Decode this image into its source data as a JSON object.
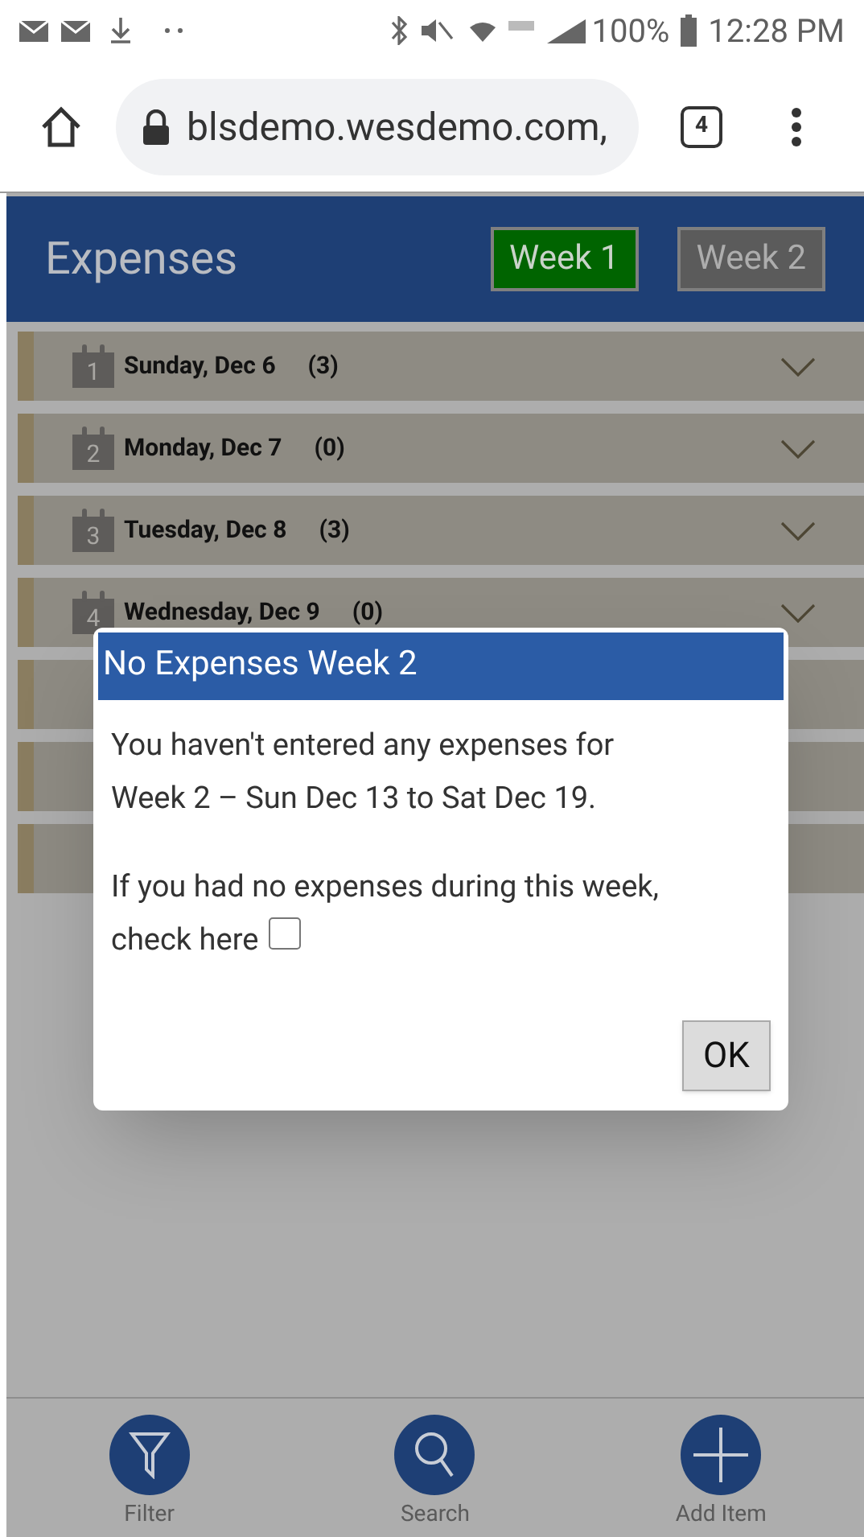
{
  "status_bar": {
    "battery": "100%",
    "time": "12:28 PM"
  },
  "browser": {
    "url": "blsdemo.wesdemo.com,",
    "tab_count": "4"
  },
  "header": {
    "title": "Expenses",
    "tabs": [
      {
        "label": "Week 1",
        "selected": true
      },
      {
        "label": "Week 2",
        "selected": false
      }
    ]
  },
  "days": [
    {
      "kind": "full",
      "day": "1",
      "label": "Sunday, Dec 6",
      "count": "(3)"
    },
    {
      "kind": "full",
      "day": "2",
      "label": "Monday, Dec 7",
      "count": "(0)"
    },
    {
      "kind": "full",
      "day": "3",
      "label": "Tuesday, Dec 8",
      "count": "(3)"
    },
    {
      "kind": "full",
      "day": "4",
      "label": "Wednesday, Dec 9",
      "count": "(0)"
    },
    {
      "kind": "covered"
    },
    {
      "kind": "covered"
    },
    {
      "kind": "covered"
    }
  ],
  "dialog": {
    "title": "No Expenses Week 2",
    "message": "You haven't entered any expenses for Week 2 – Sun Dec 13 to Sat Dec 19.",
    "prompt": "If you had no expenses during this week,",
    "checkbox_label": "check here",
    "checked": false,
    "button": "OK"
  },
  "bottom_nav": [
    {
      "kind": "filter",
      "label": "Filter"
    },
    {
      "kind": "search",
      "label": "Search"
    },
    {
      "kind": "add",
      "label": "Add Item"
    }
  ]
}
